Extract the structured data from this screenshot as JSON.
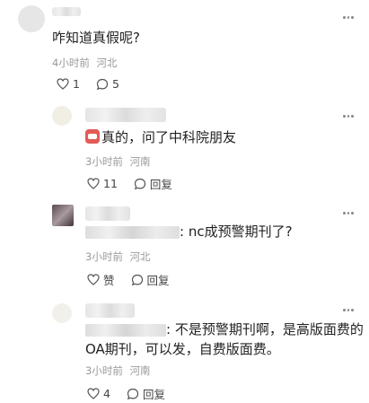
{
  "comments": [
    {
      "text": "咋知道真假呢?",
      "time": "4小时前",
      "location": "河北",
      "likes": "1",
      "replies": "5"
    },
    {
      "text": "真的，问了中科院朋友",
      "time": "3小时前",
      "location": "河南",
      "likes": "11",
      "reply_label": "回复"
    },
    {
      "text": ": nc成预警期刊了?",
      "time": "3小时前",
      "location": "河北",
      "likes": "赞",
      "reply_label": "回复"
    },
    {
      "text_line1": ": 不是预警期刊啊，是高版面费的",
      "text_line2": "OA期刊，可以发，自费版面费。",
      "time": "3小时前",
      "location": "河南",
      "likes": "4",
      "reply_label": "回复"
    }
  ],
  "icons": [
    "heart-icon",
    "comment-bubble-icon",
    "more-icon"
  ]
}
